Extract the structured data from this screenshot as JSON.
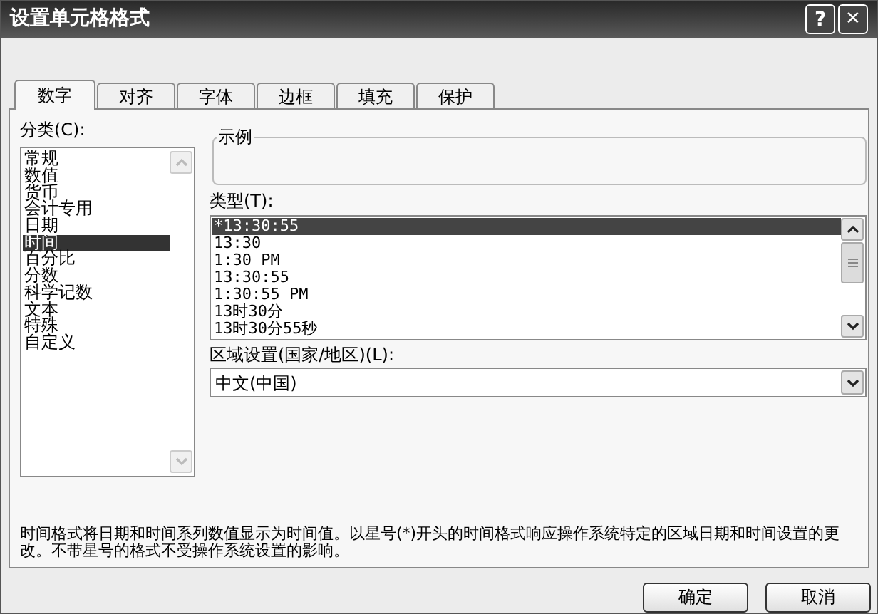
{
  "window": {
    "title": "设置单元格格式",
    "help": "?",
    "close": "✕"
  },
  "tabs": [
    {
      "label": "数字",
      "selected": true
    },
    {
      "label": "对齐",
      "selected": false
    },
    {
      "label": "字体",
      "selected": false
    },
    {
      "label": "边框",
      "selected": false
    },
    {
      "label": "填充",
      "selected": false
    },
    {
      "label": "保护",
      "selected": false
    }
  ],
  "category": {
    "label": "分类(C):",
    "items": [
      {
        "label": "常规",
        "selected": false
      },
      {
        "label": "数值",
        "selected": false
      },
      {
        "label": "货币",
        "selected": false
      },
      {
        "label": "会计专用",
        "selected": false
      },
      {
        "label": "日期",
        "selected": false
      },
      {
        "label": "时间",
        "selected": true
      },
      {
        "label": "百分比",
        "selected": false
      },
      {
        "label": "分数",
        "selected": false
      },
      {
        "label": "科学记数",
        "selected": false
      },
      {
        "label": "文本",
        "selected": false
      },
      {
        "label": "特殊",
        "selected": false
      },
      {
        "label": "自定义",
        "selected": false
      }
    ]
  },
  "sample": {
    "label": "示例"
  },
  "type": {
    "label": "类型(T):",
    "items": [
      {
        "label": "*13:30:55",
        "selected": true
      },
      {
        "label": "13:30",
        "selected": false
      },
      {
        "label": "1:30 PM",
        "selected": false
      },
      {
        "label": "13:30:55",
        "selected": false
      },
      {
        "label": "1:30:55 PM",
        "selected": false
      },
      {
        "label": "13时30分",
        "selected": false
      },
      {
        "label": "13时30分55秒",
        "selected": false
      }
    ]
  },
  "locale": {
    "label": "区域设置(国家/地区)(L):",
    "value": "中文(中国)"
  },
  "description": "时间格式将日期和时间系列数值显示为时间值。以星号(*)开头的时间格式响应操作系统特定的区域日期和时间设置的更改。不带星号的格式不受操作系统设置的影响。",
  "buttons": [
    "确定",
    "取消"
  ]
}
